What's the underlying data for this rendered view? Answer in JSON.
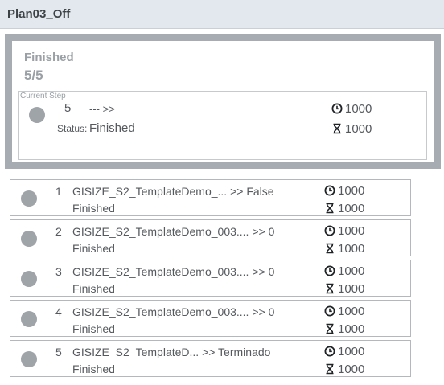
{
  "header": {
    "title": "Plan03_Off"
  },
  "summary": {
    "title": "Finished",
    "count": "5/5",
    "current_step": {
      "legend": "Current Step",
      "number": "5",
      "name": "--- >>",
      "status_label": "Status:",
      "status": "Finished",
      "time": "1000",
      "hourglass": "1000"
    }
  },
  "steps": [
    {
      "number": "1",
      "name": "GISIZE_S2_TemplateDemo_... >> False",
      "status": "Finished",
      "time": "1000",
      "hourglass": "1000"
    },
    {
      "number": "2",
      "name": "GISIZE_S2_TemplateDemo_003.... >> 0",
      "status": "Finished",
      "time": "1000",
      "hourglass": "1000"
    },
    {
      "number": "3",
      "name": "GISIZE_S2_TemplateDemo_003.... >> 0",
      "status": "Finished",
      "time": "1000",
      "hourglass": "1000"
    },
    {
      "number": "4",
      "name": "GISIZE_S2_TemplateDemo_003.... >> 0",
      "status": "Finished",
      "time": "1000",
      "hourglass": "1000"
    },
    {
      "number": "5",
      "name": "GISIZE_S2_TemplateD... >> Terminado",
      "status": "Finished",
      "time": "1000",
      "hourglass": "1000"
    }
  ],
  "icons": {
    "time": "clock-icon",
    "hourglass": "hourglass-icon",
    "status": "status-dot-icon"
  }
}
